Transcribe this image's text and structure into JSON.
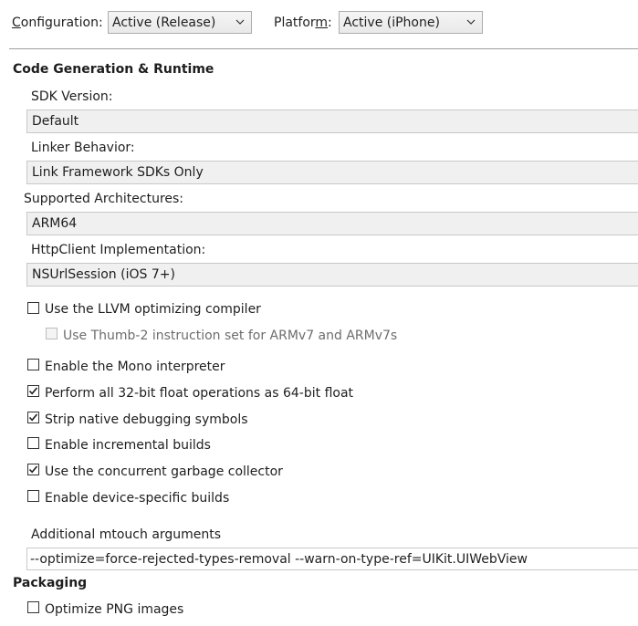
{
  "toolbar": {
    "configuration_label_pre": "C",
    "configuration_label_rest": "onfiguration:",
    "configuration_value": "Active (Release)",
    "platform_label_pre": "Platfor",
    "platform_label_ul": "m",
    "platform_label_post": ":",
    "platform_value": "Active (iPhone)"
  },
  "codegen": {
    "title": "Code Generation & Runtime",
    "sdk_version_label": "SDK Version:",
    "sdk_version_value": "Default",
    "linker_label": "Linker Behavior:",
    "linker_value": "Link Framework SDKs Only",
    "architectures_label": "Supported Architectures:",
    "architectures_value": "ARM64",
    "httpclient_label": "HttpClient Implementation:",
    "httpclient_value": "NSUrlSession (iOS 7+)"
  },
  "options": [
    {
      "label": "Use the LLVM optimizing compiler",
      "checked": false
    },
    {
      "label": "Use Thumb-2 instruction set for ARMv7 and ARMv7s",
      "checked": false,
      "disabled": true
    },
    {
      "label": "Enable the Mono interpreter",
      "checked": false
    },
    {
      "label": "Perform all 32-bit float operations as 64-bit float",
      "checked": true
    },
    {
      "label": "Strip native debugging symbols",
      "checked": true
    },
    {
      "label": "Enable incremental builds",
      "checked": false
    },
    {
      "label": "Use the concurrent garbage collector",
      "checked": true
    },
    {
      "label": "Enable device-specific builds",
      "checked": false
    }
  ],
  "mtouch": {
    "label": "Additional mtouch arguments",
    "value": "--optimize=force-rejected-types-removal --warn-on-type-ref=UIKit.UIWebView"
  },
  "packaging": {
    "title": "Packaging",
    "optimize_png_label": "Optimize PNG images",
    "optimize_png_checked": false
  },
  "colors": {
    "check": "#1e1e1e",
    "divider": "#a0a0a0",
    "dropdown_border": "#acacac"
  },
  "icons": {
    "dropdown": "chevron-down-icon",
    "check": "checkmark-icon"
  }
}
